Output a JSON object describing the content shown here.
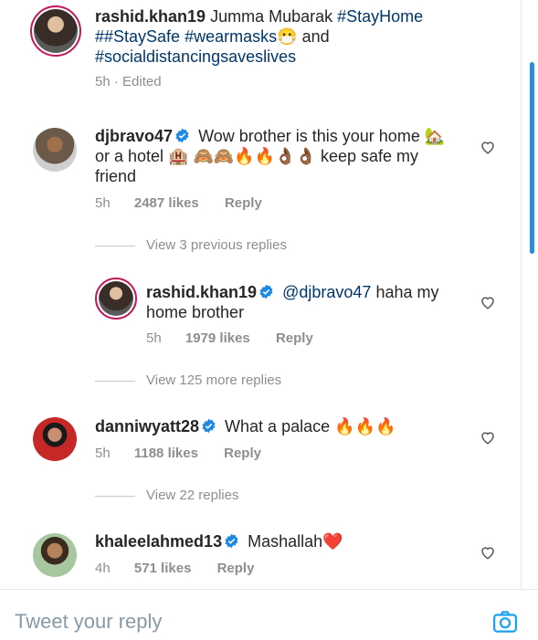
{
  "caption": {
    "username": "rashid.khan19",
    "text_line1": "Jumma Mubarak",
    "hashtag1": "#StayHome",
    "hashtag2": "##StaySafe",
    "hashtag3": "#wearmasks",
    "emoji_mask": "😷",
    "and_text": "and",
    "hashtag4": "#socialdistancingsavesl​ives",
    "meta": "5h · Edited"
  },
  "comments": [
    {
      "username": "djbravo47",
      "text_a": "Wow brother is this your home 🏡",
      "text_b": "or a hotel 🏨 🙈🙈🔥🔥👌🏾👌🏾 keep safe my",
      "text_c": "friend",
      "time": "5h",
      "likes": "2487 likes",
      "reply": "Reply"
    },
    {
      "username": "danniwyatt28",
      "text_a": "What a palace 🔥🔥🔥",
      "time": "5h",
      "likes": "1188 likes",
      "reply": "Reply"
    },
    {
      "username": "khaleelahmed13",
      "text_a": "Mashallah❤️",
      "time": "4h",
      "likes": "571 likes",
      "reply": "Reply"
    }
  ],
  "view_previous": "View 3 previous replies",
  "reply1": {
    "username": "rashid.khan19",
    "mention": "@djbravo47",
    "text_a": "haha my",
    "text_b": "home brother",
    "time": "5h",
    "likes": "1979 likes",
    "reply": "Reply"
  },
  "view_more": "View 125 more replies",
  "view_22": "View 22 replies",
  "bottom": {
    "placeholder": "Tweet your reply"
  },
  "colors": {
    "accent": "#2a8fd8",
    "hashtag": "#00376b",
    "verified": "#1e88e5",
    "camera": "#1da1f2"
  }
}
